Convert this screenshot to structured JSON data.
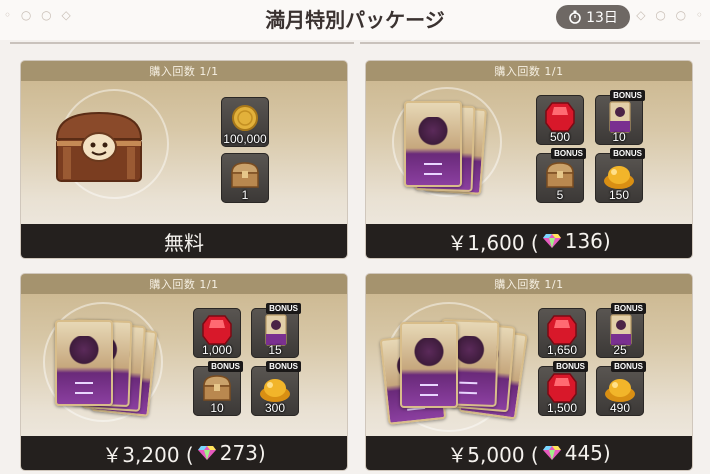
{
  "header": {
    "title": "満月特別パッケージ",
    "days_remaining": "13日"
  },
  "colors": {
    "card_top": "#a5936e",
    "price_bar": "#24201e",
    "background": "#f4f1ee"
  },
  "packages": [
    {
      "limit": "購入回数 1/1",
      "art": "treasure-chest",
      "price": "無料",
      "gems": "",
      "items": [
        {
          "icon": "gold-coin-icon",
          "qty": "100,000",
          "bonus": ""
        },
        {
          "icon": "chest-icon",
          "qty": "1",
          "bonus": ""
        }
      ]
    },
    {
      "limit": "購入回数 1/1",
      "art": "card-stack",
      "price": "￥1,600 (",
      "gems": "136)",
      "items": [
        {
          "icon": "ruby-icon",
          "qty": "500",
          "bonus": ""
        },
        {
          "icon": "card-icon",
          "qty": "10",
          "bonus": "BONUS"
        },
        {
          "icon": "chest-icon",
          "qty": "5",
          "bonus": "BONUS"
        },
        {
          "icon": "gold-pile-icon",
          "qty": "150",
          "bonus": "BONUS"
        }
      ]
    },
    {
      "limit": "購入回数 1/1",
      "art": "card-stack",
      "price": "￥3,200 (",
      "gems": "273)",
      "items": [
        {
          "icon": "ruby-icon",
          "qty": "1,000",
          "bonus": ""
        },
        {
          "icon": "card-icon",
          "qty": "15",
          "bonus": "BONUS"
        },
        {
          "icon": "chest-icon",
          "qty": "10",
          "bonus": "BONUS"
        },
        {
          "icon": "gold-pile-icon",
          "qty": "300",
          "bonus": "BONUS"
        }
      ]
    },
    {
      "limit": "購入回数 1/1",
      "art": "card-stack",
      "price": "￥5,000 (",
      "gems": "445)",
      "items": [
        {
          "icon": "ruby-icon",
          "qty": "1,650",
          "bonus": ""
        },
        {
          "icon": "card-icon",
          "qty": "25",
          "bonus": "BONUS"
        },
        {
          "icon": "ruby-icon",
          "qty": "1,500",
          "bonus": "BONUS"
        },
        {
          "icon": "gold-pile-icon",
          "qty": "490",
          "bonus": "BONUS"
        }
      ]
    }
  ]
}
